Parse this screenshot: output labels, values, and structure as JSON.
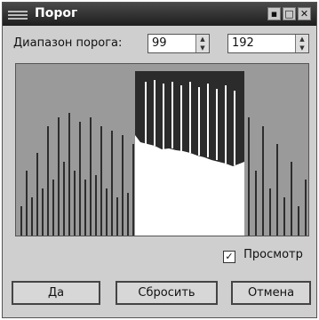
{
  "window": {
    "title": "Порог",
    "controls": {
      "minimize": "▪",
      "maximize": "□",
      "close": "✕"
    }
  },
  "threshold": {
    "range_label": "Диапазон порога:",
    "low": "99",
    "high": "192"
  },
  "histogram": {
    "selected_range": [
      99,
      192
    ],
    "colors": {
      "background": "#9a9a9a",
      "selection": "#2b2b2b",
      "bars": "#2d2d2d",
      "selected_bars": "#ffffff"
    }
  },
  "preview": {
    "label": "Просмотр",
    "checked": true
  },
  "buttons": {
    "ok": "Да",
    "reset": "Сбросить",
    "cancel": "Отмена"
  }
}
